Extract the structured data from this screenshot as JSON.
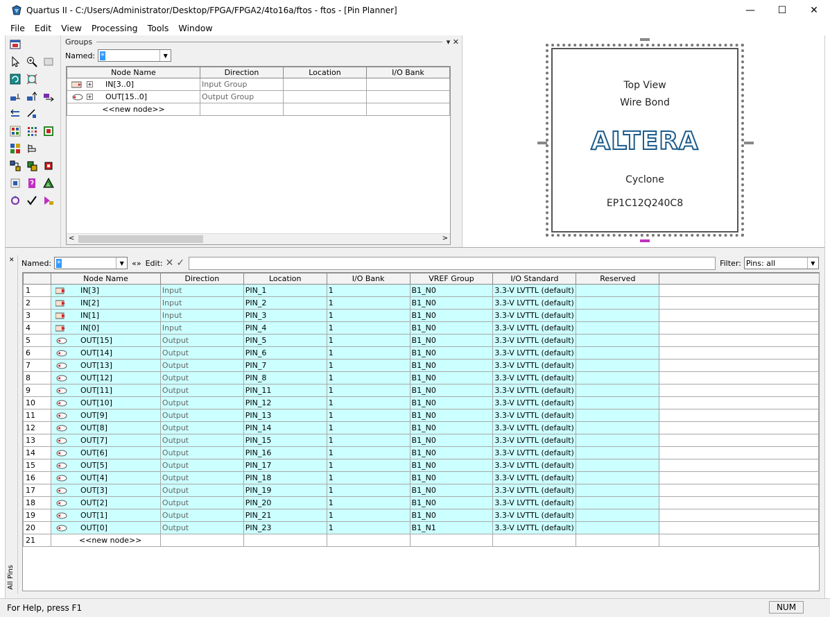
{
  "window": {
    "title": "Quartus II - C:/Users/Administrator/Desktop/FPGA/FPGA2/4to16a/ftos - ftos - [Pin Planner]",
    "minimize": "—",
    "maximize": "☐",
    "close": "✕"
  },
  "menu": [
    "File",
    "Edit",
    "View",
    "Processing",
    "Tools",
    "Window"
  ],
  "groups": {
    "title": "Groups",
    "named_label": "Named:",
    "named_value": "*",
    "header_controls": "▾ ✕",
    "columns": [
      "Node Name",
      "Direction",
      "Location",
      "I/O Bank"
    ],
    "rows": [
      {
        "name": "IN[3..0]",
        "direction": "Input Group",
        "location": "",
        "bank": ""
      },
      {
        "name": "OUT[15..0]",
        "direction": "Output Group",
        "location": "",
        "bank": ""
      }
    ],
    "new_node": "<<new node>>"
  },
  "chip": {
    "view": "Top View",
    "bond": "Wire Bond",
    "logo": "ALTERA",
    "family": "Cyclone",
    "part": "EP1C12Q240C8"
  },
  "pins": {
    "named_label": "Named:",
    "named_value": "*",
    "expand": "«»",
    "edit_label": "Edit:",
    "filter_label": "Filter:",
    "filter_value": "Pins: all",
    "side_tab": "All Pins",
    "columns": [
      "Node Name",
      "Direction",
      "Location",
      "I/O Bank",
      "VREF Group",
      "I/O Standard",
      "Reserved"
    ],
    "rows": [
      {
        "num": "1",
        "name": "IN[3]",
        "dir": "Input",
        "loc": "PIN_1",
        "bank": "1",
        "vref": "B1_N0",
        "std": "3.3-V LVTTL (default)"
      },
      {
        "num": "2",
        "name": "IN[2]",
        "dir": "Input",
        "loc": "PIN_2",
        "bank": "1",
        "vref": "B1_N0",
        "std": "3.3-V LVTTL (default)"
      },
      {
        "num": "3",
        "name": "IN[1]",
        "dir": "Input",
        "loc": "PIN_3",
        "bank": "1",
        "vref": "B1_N0",
        "std": "3.3-V LVTTL (default)"
      },
      {
        "num": "4",
        "name": "IN[0]",
        "dir": "Input",
        "loc": "PIN_4",
        "bank": "1",
        "vref": "B1_N0",
        "std": "3.3-V LVTTL (default)"
      },
      {
        "num": "5",
        "name": "OUT[15]",
        "dir": "Output",
        "loc": "PIN_5",
        "bank": "1",
        "vref": "B1_N0",
        "std": "3.3-V LVTTL (default)"
      },
      {
        "num": "6",
        "name": "OUT[14]",
        "dir": "Output",
        "loc": "PIN_6",
        "bank": "1",
        "vref": "B1_N0",
        "std": "3.3-V LVTTL (default)"
      },
      {
        "num": "7",
        "name": "OUT[13]",
        "dir": "Output",
        "loc": "PIN_7",
        "bank": "1",
        "vref": "B1_N0",
        "std": "3.3-V LVTTL (default)"
      },
      {
        "num": "8",
        "name": "OUT[12]",
        "dir": "Output",
        "loc": "PIN_8",
        "bank": "1",
        "vref": "B1_N0",
        "std": "3.3-V LVTTL (default)"
      },
      {
        "num": "9",
        "name": "OUT[11]",
        "dir": "Output",
        "loc": "PIN_11",
        "bank": "1",
        "vref": "B1_N0",
        "std": "3.3-V LVTTL (default)"
      },
      {
        "num": "10",
        "name": "OUT[10]",
        "dir": "Output",
        "loc": "PIN_12",
        "bank": "1",
        "vref": "B1_N0",
        "std": "3.3-V LVTTL (default)"
      },
      {
        "num": "11",
        "name": "OUT[9]",
        "dir": "Output",
        "loc": "PIN_13",
        "bank": "1",
        "vref": "B1_N0",
        "std": "3.3-V LVTTL (default)"
      },
      {
        "num": "12",
        "name": "OUT[8]",
        "dir": "Output",
        "loc": "PIN_14",
        "bank": "1",
        "vref": "B1_N0",
        "std": "3.3-V LVTTL (default)"
      },
      {
        "num": "13",
        "name": "OUT[7]",
        "dir": "Output",
        "loc": "PIN_15",
        "bank": "1",
        "vref": "B1_N0",
        "std": "3.3-V LVTTL (default)"
      },
      {
        "num": "14",
        "name": "OUT[6]",
        "dir": "Output",
        "loc": "PIN_16",
        "bank": "1",
        "vref": "B1_N0",
        "std": "3.3-V LVTTL (default)"
      },
      {
        "num": "15",
        "name": "OUT[5]",
        "dir": "Output",
        "loc": "PIN_17",
        "bank": "1",
        "vref": "B1_N0",
        "std": "3.3-V LVTTL (default)"
      },
      {
        "num": "16",
        "name": "OUT[4]",
        "dir": "Output",
        "loc": "PIN_18",
        "bank": "1",
        "vref": "B1_N0",
        "std": "3.3-V LVTTL (default)"
      },
      {
        "num": "17",
        "name": "OUT[3]",
        "dir": "Output",
        "loc": "PIN_19",
        "bank": "1",
        "vref": "B1_N0",
        "std": "3.3-V LVTTL (default)"
      },
      {
        "num": "18",
        "name": "OUT[2]",
        "dir": "Output",
        "loc": "PIN_20",
        "bank": "1",
        "vref": "B1_N0",
        "std": "3.3-V LVTTL (default)"
      },
      {
        "num": "19",
        "name": "OUT[1]",
        "dir": "Output",
        "loc": "PIN_21",
        "bank": "1",
        "vref": "B1_N0",
        "std": "3.3-V LVTTL (default)"
      },
      {
        "num": "20",
        "name": "OUT[0]",
        "dir": "Output",
        "loc": "PIN_23",
        "bank": "1",
        "vref": "B1_N1",
        "std": "3.3-V LVTTL (default)"
      }
    ],
    "new_row_num": "21",
    "new_node": "<<new node>>"
  },
  "status": {
    "help": "For Help, press F1",
    "num": "NUM"
  },
  "colors": {
    "assigned_cell": "#ccffff",
    "logo_blue": "#1a5a8a"
  }
}
